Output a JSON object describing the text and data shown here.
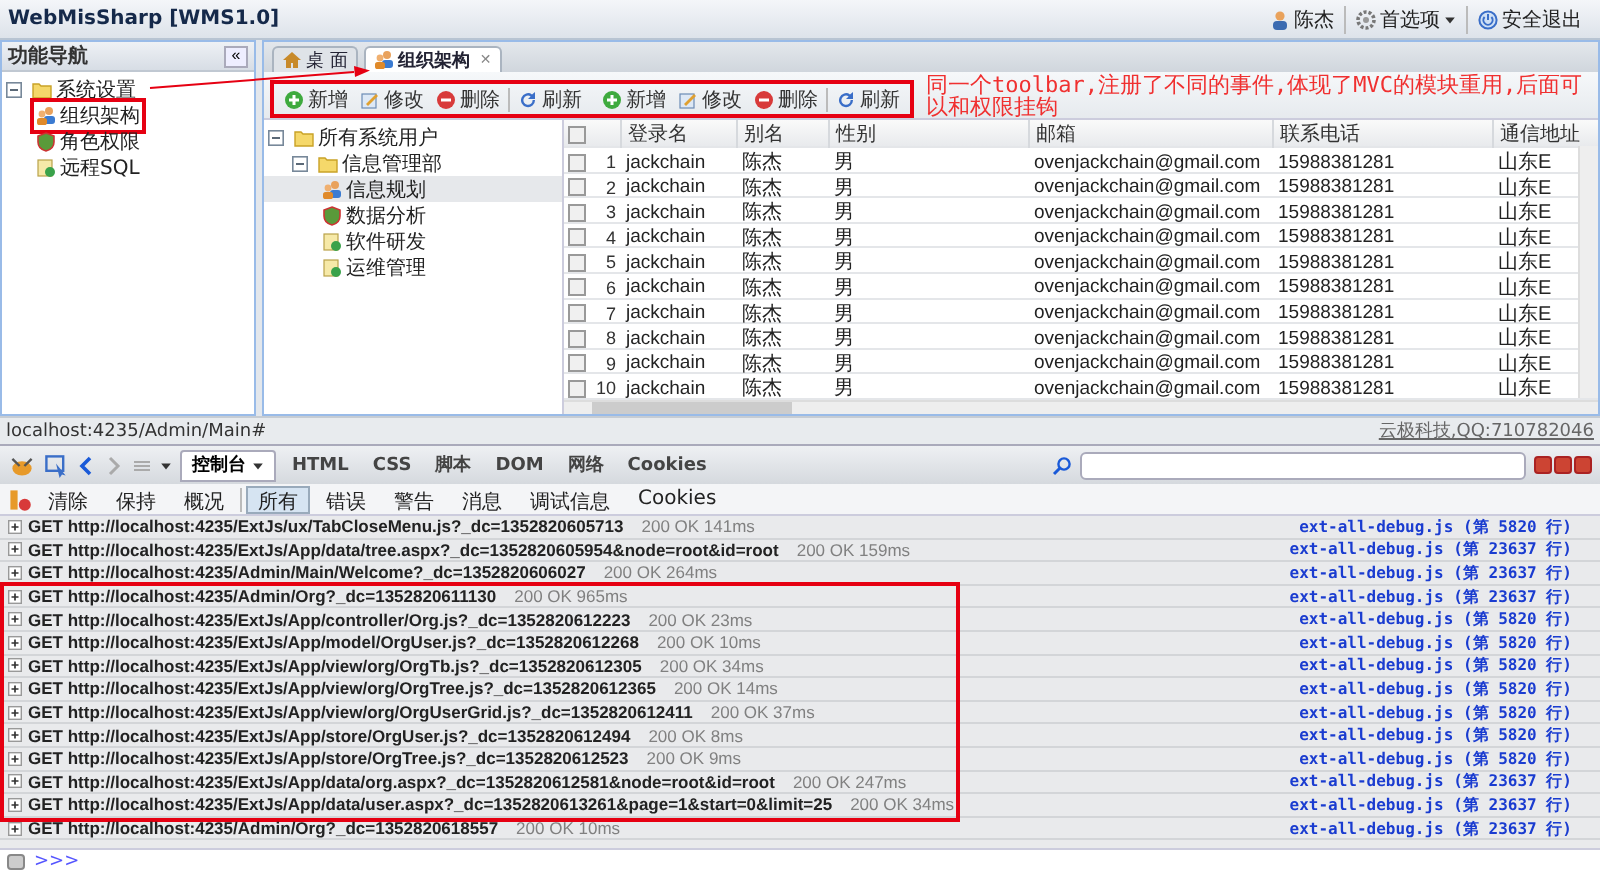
{
  "header": {
    "title": "WebMisSharp [WMS1.0]",
    "user": "陈杰",
    "preferences": "首选项",
    "logout": "安全退出"
  },
  "nav": {
    "title": "功能导航",
    "collapse": "«",
    "tree": [
      {
        "label": "系统设置",
        "expanded": true,
        "selected": false,
        "children": [
          {
            "label": "组织架构",
            "selected": true
          },
          {
            "label": "角色权限",
            "selected": false
          },
          {
            "label": "远程SQL",
            "selected": false
          }
        ]
      }
    ]
  },
  "tabs": [
    {
      "label": "桌 面",
      "selected": false
    },
    {
      "label": "组织架构",
      "selected": true,
      "close": "✕"
    }
  ],
  "toolbars": [
    {
      "buttons": [
        {
          "kind": "add",
          "label": "新增"
        },
        {
          "kind": "edit",
          "label": "修改"
        },
        {
          "kind": "delete",
          "label": "删除"
        },
        {
          "kind": "separator"
        },
        {
          "kind": "refresh",
          "label": "刷新"
        }
      ]
    },
    {
      "buttons": [
        {
          "kind": "add",
          "label": "新增"
        },
        {
          "kind": "edit",
          "label": "修改"
        },
        {
          "kind": "delete",
          "label": "删除"
        },
        {
          "kind": "separator"
        },
        {
          "kind": "refresh",
          "label": "刷新"
        }
      ]
    }
  ],
  "annotation": "同一个toolbar,注册了不同的事件,体现了MVC的模块重用,后面可以和权限挂钩",
  "org_tree": [
    {
      "label": "所有系统用户",
      "expanded": true,
      "selected": false,
      "children": [
        {
          "label": "信息管理部",
          "expanded": true,
          "selected": false,
          "children": [
            {
              "label": "信息规划",
              "selected": true
            },
            {
              "label": "数据分析",
              "selected": false
            },
            {
              "label": "软件研发",
              "selected": false
            },
            {
              "label": "运维管理",
              "selected": false
            }
          ]
        }
      ]
    }
  ],
  "grid": {
    "all_checked": false,
    "columns": [
      "登录名",
      "别名",
      "性别",
      "邮箱",
      "联系电话",
      "通信地址"
    ],
    "rows": [
      {
        "num": "1",
        "checked": false,
        "cells": [
          "jackchain",
          "陈杰",
          "男",
          "ovenjackchain@gmail.com",
          "15988381281",
          "山东E"
        ]
      },
      {
        "num": "2",
        "checked": false,
        "cells": [
          "jackchain",
          "陈杰",
          "男",
          "ovenjackchain@gmail.com",
          "15988381281",
          "山东E"
        ]
      },
      {
        "num": "3",
        "checked": false,
        "cells": [
          "jackchain",
          "陈杰",
          "男",
          "ovenjackchain@gmail.com",
          "15988381281",
          "山东E"
        ]
      },
      {
        "num": "4",
        "checked": false,
        "cells": [
          "jackchain",
          "陈杰",
          "男",
          "ovenjackchain@gmail.com",
          "15988381281",
          "山东E"
        ]
      },
      {
        "num": "5",
        "checked": false,
        "cells": [
          "jackchain",
          "陈杰",
          "男",
          "ovenjackchain@gmail.com",
          "15988381281",
          "山东E"
        ]
      },
      {
        "num": "6",
        "checked": false,
        "cells": [
          "jackchain",
          "陈杰",
          "男",
          "ovenjackchain@gmail.com",
          "15988381281",
          "山东E"
        ]
      },
      {
        "num": "7",
        "checked": false,
        "cells": [
          "jackchain",
          "陈杰",
          "男",
          "ovenjackchain@gmail.com",
          "15988381281",
          "山东E"
        ]
      },
      {
        "num": "8",
        "checked": false,
        "cells": [
          "jackchain",
          "陈杰",
          "男",
          "ovenjackchain@gmail.com",
          "15988381281",
          "山东E"
        ]
      },
      {
        "num": "9",
        "checked": false,
        "cells": [
          "jackchain",
          "陈杰",
          "男",
          "ovenjackchain@gmail.com",
          "15988381281",
          "山东E"
        ]
      },
      {
        "num": "10",
        "checked": false,
        "cells": [
          "jackchain",
          "陈杰",
          "男",
          "ovenjackchain@gmail.com",
          "15988381281",
          "山东E"
        ]
      }
    ]
  },
  "status_bar": {
    "url": "localhost:4235/Admin/Main#",
    "credit": "云极科技,QQ:710782046"
  },
  "firebug": {
    "panel_menu": "控制台",
    "tabs": [
      "HTML",
      "CSS",
      "脚本",
      "DOM",
      "网络",
      "Cookies"
    ],
    "actions": [
      "清除",
      "保持",
      "概况"
    ],
    "filters": [
      {
        "label": "所有",
        "selected": true
      },
      {
        "label": "错误",
        "selected": false
      },
      {
        "label": "警告",
        "selected": false
      },
      {
        "label": "消息",
        "selected": false
      },
      {
        "label": "调试信息",
        "selected": false
      },
      {
        "label": "Cookies",
        "selected": false
      }
    ],
    "request_groups": [
      {
        "highlighted": false,
        "requests": [
          {
            "method": "GET",
            "url": "http://localhost:4235/ExtJs/ux/TabCloseMenu.js?_dc=1352820605713",
            "status": "200 OK 141ms",
            "source": "ext-all-debug.js (第 5820 行)"
          },
          {
            "method": "GET",
            "url": "http://localhost:4235/ExtJs/App/data/tree.aspx?_dc=1352820605954&node=root&id=root",
            "status": "200 OK 159ms",
            "source": "ext-all-debug.js (第 23637 行)"
          },
          {
            "method": "GET",
            "url": "http://localhost:4235/Admin/Main/Welcome?_dc=1352820606027",
            "status": "200 OK 264ms",
            "source": "ext-all-debug.js (第 23637 行)"
          }
        ]
      },
      {
        "highlighted": true,
        "requests": [
          {
            "method": "GET",
            "url": "http://localhost:4235/Admin/Org?_dc=1352820611130",
            "status": "200 OK 965ms",
            "source": "ext-all-debug.js (第 23637 行)"
          },
          {
            "method": "GET",
            "url": "http://localhost:4235/ExtJs/App/controller/Org.js?_dc=1352820612223",
            "status": "200 OK 23ms",
            "source": "ext-all-debug.js (第 5820 行)"
          },
          {
            "method": "GET",
            "url": "http://localhost:4235/ExtJs/App/model/OrgUser.js?_dc=1352820612268",
            "status": "200 OK 10ms",
            "source": "ext-all-debug.js (第 5820 行)"
          },
          {
            "method": "GET",
            "url": "http://localhost:4235/ExtJs/App/view/org/OrgTb.js?_dc=1352820612305",
            "status": "200 OK 34ms",
            "source": "ext-all-debug.js (第 5820 行)"
          },
          {
            "method": "GET",
            "url": "http://localhost:4235/ExtJs/App/view/org/OrgTree.js?_dc=1352820612365",
            "status": "200 OK 14ms",
            "source": "ext-all-debug.js (第 5820 行)"
          },
          {
            "method": "GET",
            "url": "http://localhost:4235/ExtJs/App/view/org/OrgUserGrid.js?_dc=1352820612411",
            "status": "200 OK 37ms",
            "source": "ext-all-debug.js (第 5820 行)"
          },
          {
            "method": "GET",
            "url": "http://localhost:4235/ExtJs/App/store/OrgUser.js?_dc=1352820612494",
            "status": "200 OK 8ms",
            "source": "ext-all-debug.js (第 5820 行)"
          },
          {
            "method": "GET",
            "url": "http://localhost:4235/ExtJs/App/store/OrgTree.js?_dc=1352820612523",
            "status": "200 OK 9ms",
            "source": "ext-all-debug.js (第 5820 行)"
          },
          {
            "method": "GET",
            "url": "http://localhost:4235/ExtJs/App/data/org.aspx?_dc=1352820612581&node=root&id=root",
            "status": "200 OK 247ms",
            "source": "ext-all-debug.js (第 23637 行)"
          },
          {
            "method": "GET",
            "url": "http://localhost:4235/ExtJs/App/data/user.aspx?_dc=1352820613261&page=1&start=0&limit=25",
            "status": "200 OK 34ms",
            "source": "ext-all-debug.js (第 23637 行)"
          }
        ]
      },
      {
        "highlighted": false,
        "requests": [
          {
            "method": "GET",
            "url": "http://localhost:4235/Admin/Org?_dc=1352820618557",
            "status": "200 OK 10ms",
            "source": "ext-all-debug.js (第 23637 行)"
          }
        ]
      }
    ],
    "prompt": ">>>"
  }
}
